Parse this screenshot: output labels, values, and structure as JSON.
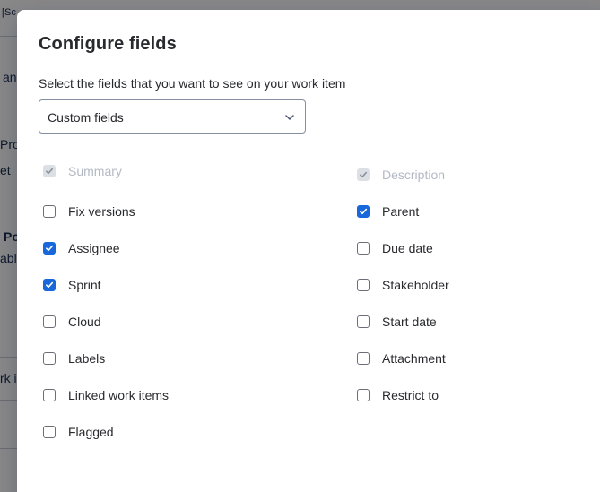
{
  "background": {
    "fragments": [
      "[Sc",
      "an",
      "Pro",
      "et",
      "Po",
      "abl",
      "rk i"
    ]
  },
  "modal": {
    "title": "Configure fields",
    "description": "Select the fields that you want to see on your work item",
    "select": {
      "value": "Custom fields",
      "icon": "chevron-down-icon"
    },
    "accent_color": "#1868db",
    "fields_left": [
      {
        "label": "Summary",
        "checked": true,
        "disabled": true
      },
      {
        "label": "Fix versions",
        "checked": false,
        "disabled": false
      },
      {
        "label": "Assignee",
        "checked": true,
        "disabled": false
      },
      {
        "label": "Sprint",
        "checked": true,
        "disabled": false
      },
      {
        "label": "Cloud",
        "checked": false,
        "disabled": false
      },
      {
        "label": "Labels",
        "checked": false,
        "disabled": false
      },
      {
        "label": "Linked work items",
        "checked": false,
        "disabled": false
      },
      {
        "label": "Flagged",
        "checked": false,
        "disabled": false
      }
    ],
    "fields_right": [
      {
        "label": "Description",
        "checked": true,
        "disabled": true
      },
      {
        "label": "Parent",
        "checked": true,
        "disabled": false
      },
      {
        "label": "Due date",
        "checked": false,
        "disabled": false
      },
      {
        "label": "Stakeholder",
        "checked": false,
        "disabled": false
      },
      {
        "label": "Start date",
        "checked": false,
        "disabled": false
      },
      {
        "label": "Attachment",
        "checked": false,
        "disabled": false
      },
      {
        "label": "Restrict to",
        "checked": false,
        "disabled": false
      }
    ]
  }
}
